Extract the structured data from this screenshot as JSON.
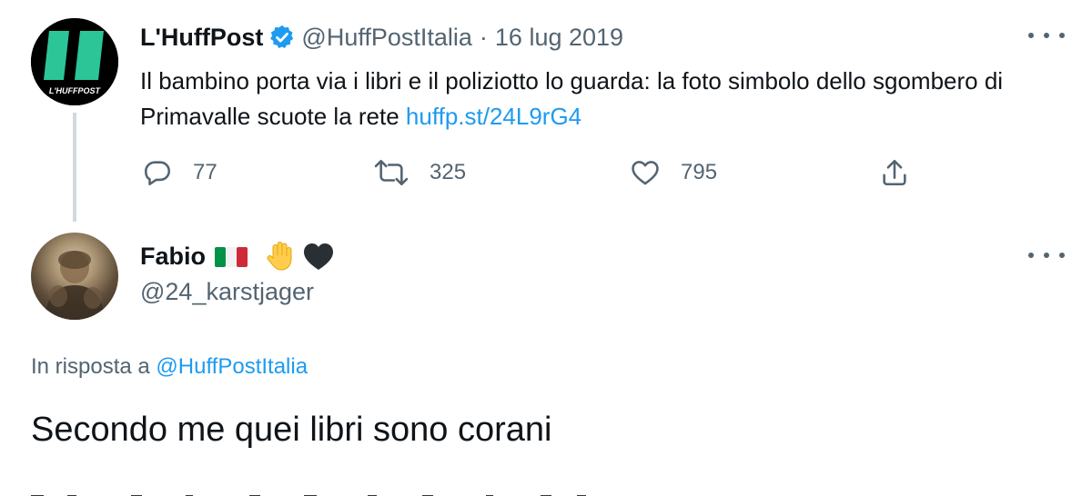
{
  "original_tweet": {
    "author_name": "L'HuffPost",
    "author_handle": "@HuffPostItalia",
    "separator": "·",
    "date": "16 lug 2019",
    "avatar_logo_text": "L'HUFFPOST",
    "text": "Il bambino porta via i libri e il poliziotto lo guarda: la foto simbolo dello sgombero di Primavalle scuote la rete",
    "link": "huffp.st/24L9rG4",
    "replies": "77",
    "retweets": "325",
    "likes": "795"
  },
  "reply_tweet": {
    "author_name": "Fabio",
    "author_handle": "@24_karstjager",
    "in_reply_prefix": "In risposta a",
    "in_reply_handle": "@HuffPostItalia",
    "text": "Secondo me quei libri sono corani"
  },
  "colors": {
    "text_primary": "#0f1419",
    "text_secondary": "#536471",
    "link": "#1d9bf0",
    "thread_line": "#cfd9de",
    "huffpost_green": "#2bc598"
  },
  "icons": [
    "verified-badge-icon",
    "more-options-icon",
    "reply-icon",
    "retweet-icon",
    "like-icon",
    "share-icon",
    "italy-flag-icon",
    "raised-hand-icon",
    "black-heart-icon"
  ]
}
